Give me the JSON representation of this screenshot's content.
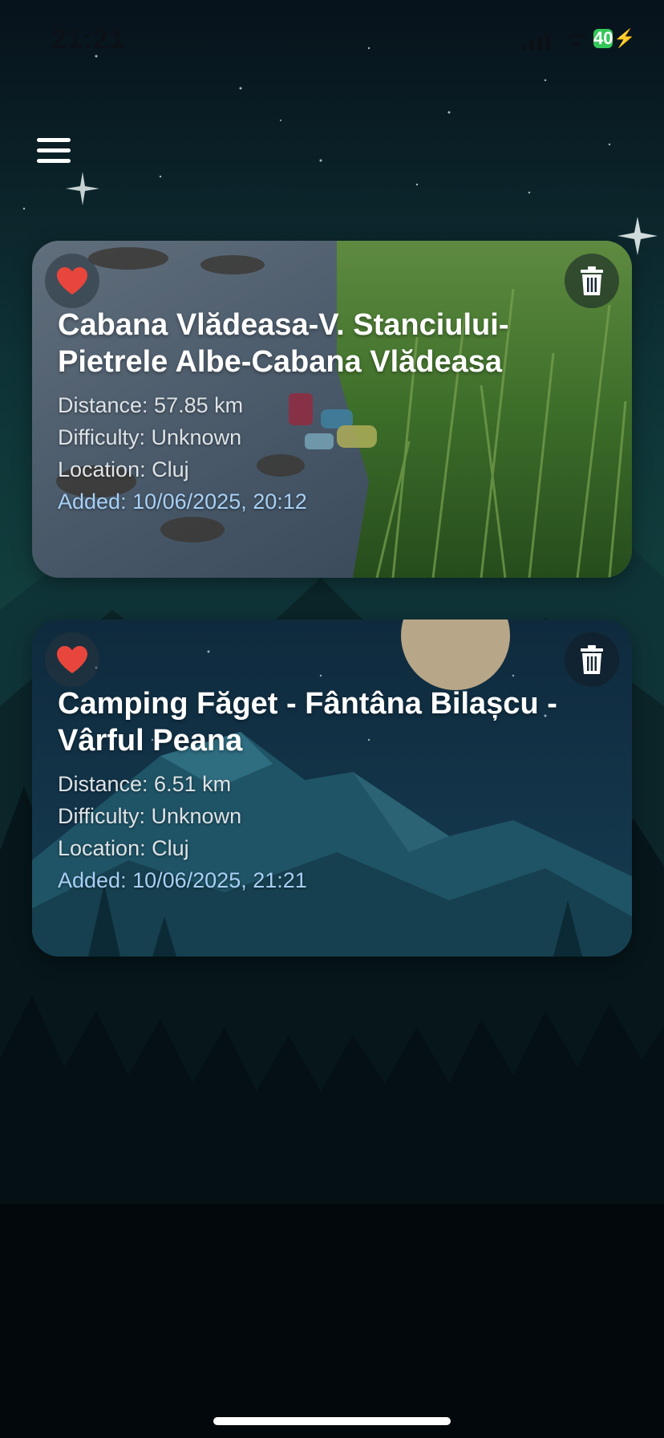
{
  "status_bar": {
    "time": "21:21",
    "battery_level": "40",
    "battery_color": "#34c759"
  },
  "header": {
    "menu_icon": "hamburger-menu-icon"
  },
  "trails": [
    {
      "title": "Cabana Vlădeasa-V. Stanciului-Pietrele Albe-Cabana Vlădeasa",
      "distance": "Distance: 57.85 km",
      "difficulty": "Difficulty: Unknown",
      "location": "Location: Cluj",
      "added": "Added: 10/06/2025, 20:12",
      "favorite_icon": "heart-icon",
      "delete_icon": "trash-icon",
      "favorite": true
    },
    {
      "title": "Camping Făget - Fântâna Bilașcu - Vârful Peana",
      "distance": "Distance: 6.51 km",
      "difficulty": "Difficulty: Unknown",
      "location": "Location: Cluj",
      "added": "Added: 10/06/2025, 21:21",
      "favorite_icon": "heart-icon",
      "delete_icon": "trash-icon",
      "favorite": true
    }
  ],
  "colors": {
    "heart": "#e8463c",
    "added_text": "#a8d0f5",
    "background": "#071420"
  }
}
